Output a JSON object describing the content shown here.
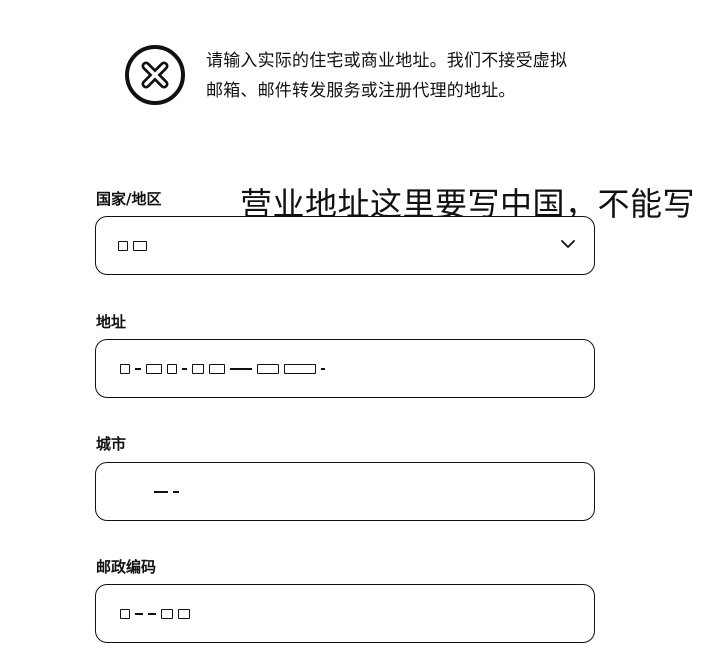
{
  "alert": {
    "icon": "x-circle-icon",
    "message": "请输入实际的住宅或商业地址。我们不接受虚拟邮箱、邮件转发服务或注册代理的地址。"
  },
  "annotation": {
    "text": "营业地址这里要写中国，不能写英国公司地址"
  },
  "form": {
    "country": {
      "label": "国家/地区",
      "value_redacted": true,
      "icon": "chevron-down-icon"
    },
    "address": {
      "label": "地址",
      "value_redacted": true
    },
    "city": {
      "label": "城市",
      "value_redacted": true
    },
    "postal_code": {
      "label": "邮政编码",
      "value_redacted": true
    }
  }
}
